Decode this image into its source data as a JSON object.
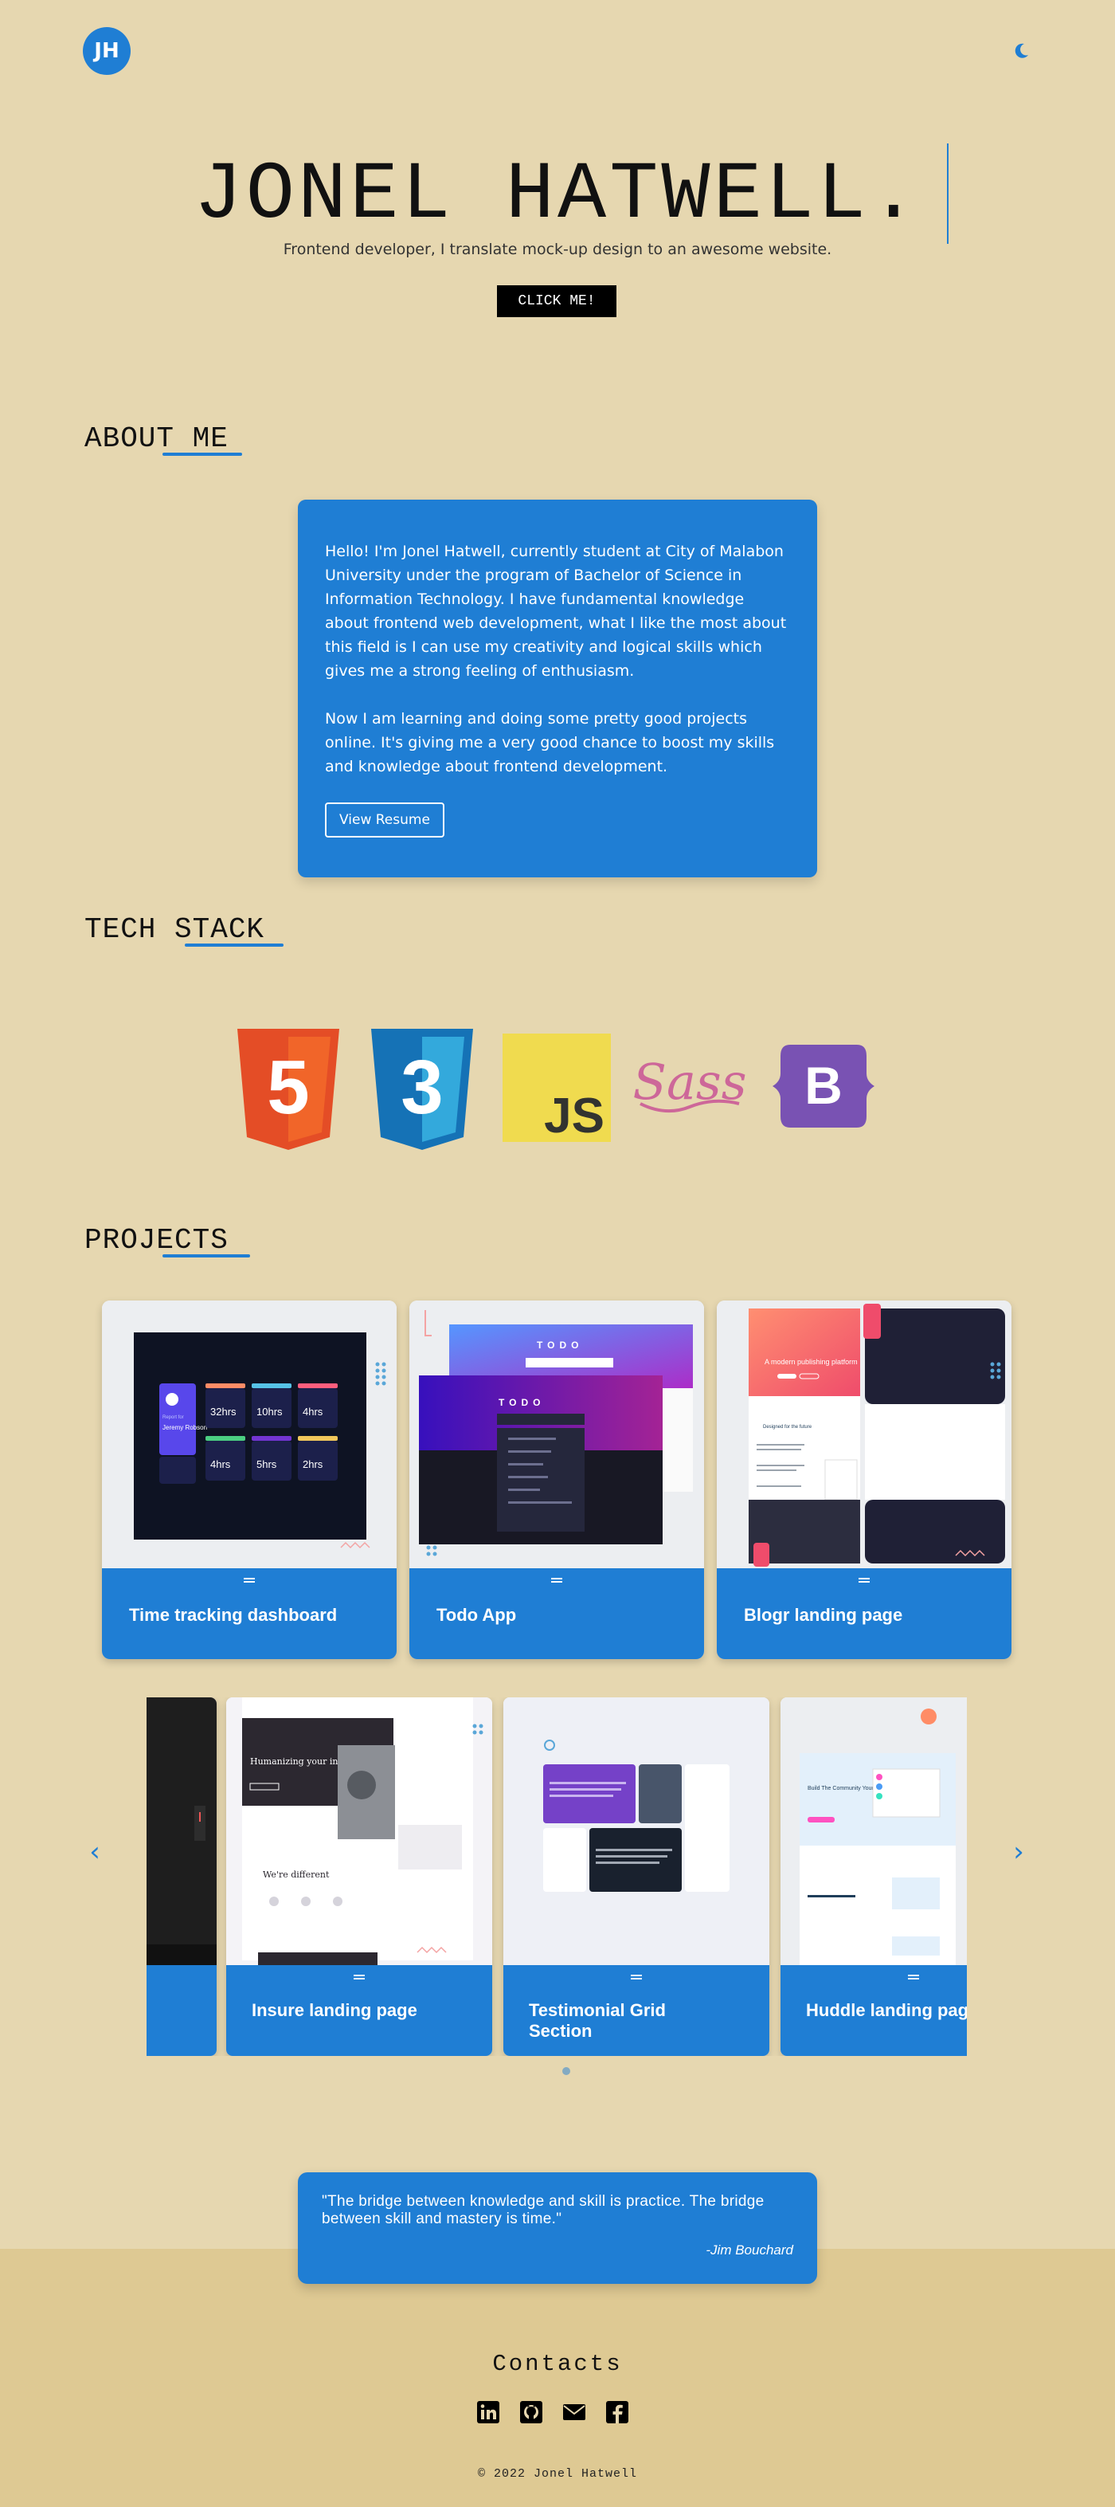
{
  "header": {
    "logo_text": "JH",
    "theme_toggle_icon": "moon-icon"
  },
  "hero": {
    "name": "JONEL HATWELL.",
    "subtitle": "Frontend developer, I translate mock-up design to an awesome website.",
    "cta_label": "CLICK ME!"
  },
  "about": {
    "heading": "ABOUT ME",
    "paragraph_1": "Hello! I'm Jonel Hatwell, currently student at City of Malabon University under the program of Bachelor of Science in Information Technology. I have fundamental knowledge about frontend web development, what I like the most about this field is I can use my creativity and logical skills which gives me a strong feeling of enthusiasm.",
    "paragraph_2": "Now I am learning and doing some pretty good projects online. It's giving me a very good chance to boost my skills and knowledge about frontend development.",
    "resume_label": "View Resume"
  },
  "tech_stack": {
    "heading": "TECH STACK",
    "items": [
      {
        "name": "html5",
        "icon": "html5-logo-icon",
        "label": "5",
        "color": "#e44d26"
      },
      {
        "name": "css3",
        "icon": "css3-logo-icon",
        "label": "3",
        "color": "#1572b6"
      },
      {
        "name": "javascript",
        "icon": "javascript-logo-icon",
        "label": "JS",
        "color": "#f0db4f"
      },
      {
        "name": "sass",
        "icon": "sass-logo-icon",
        "label": "Sass",
        "color": "#cd6799"
      },
      {
        "name": "bootstrap",
        "icon": "bootstrap-logo-icon",
        "label": "B",
        "color": "#7952b3"
      }
    ]
  },
  "projects": {
    "heading": "PROJECTS",
    "featured": [
      {
        "title": "Time tracking dashboard"
      },
      {
        "title": "Todo App"
      },
      {
        "title": "Blogr landing page"
      }
    ],
    "carousel": [
      {
        "title": ""
      },
      {
        "title": "Insure landing page"
      },
      {
        "title": "Testimonial Grid Section"
      },
      {
        "title": "Huddle landing page"
      }
    ],
    "thumbnails": {
      "time_tracking": {
        "user_label": "Report for",
        "user_name": "Jeremy Robson",
        "stats": [
          "32hrs",
          "10hrs",
          "4hrs",
          "4hrs",
          "5hrs",
          "2hrs"
        ]
      },
      "todo": {
        "title": "TODO"
      },
      "blogr": {
        "headline": "A modern publishing platform",
        "section": "Designed for the future"
      },
      "insure": {
        "headline": "Humanizing your insurance.",
        "section": "We're different"
      },
      "huddle": {
        "headline": "Build The Community Your Fans Will Love"
      }
    },
    "prev_icon": "chevron-left-icon",
    "next_icon": "chevron-right-icon",
    "colors": {
      "accent": "#1f7ed4"
    }
  },
  "quote": {
    "text": "\"The bridge between knowledge and skill is practice. The bridge between skill and mastery is time.\"",
    "author": "-Jim Bouchard"
  },
  "footer": {
    "contacts_title": "Contacts",
    "socials": [
      {
        "name": "linkedin",
        "icon": "linkedin-icon"
      },
      {
        "name": "github",
        "icon": "github-icon"
      },
      {
        "name": "email",
        "icon": "envelope-icon"
      },
      {
        "name": "facebook",
        "icon": "facebook-icon"
      }
    ],
    "copyright": "© 2022 Jonel Hatwell"
  },
  "colors": {
    "background": "#e6d7b0",
    "footer_background": "#dec993",
    "accent": "#1f7ed4",
    "button_dark": "#000000"
  }
}
